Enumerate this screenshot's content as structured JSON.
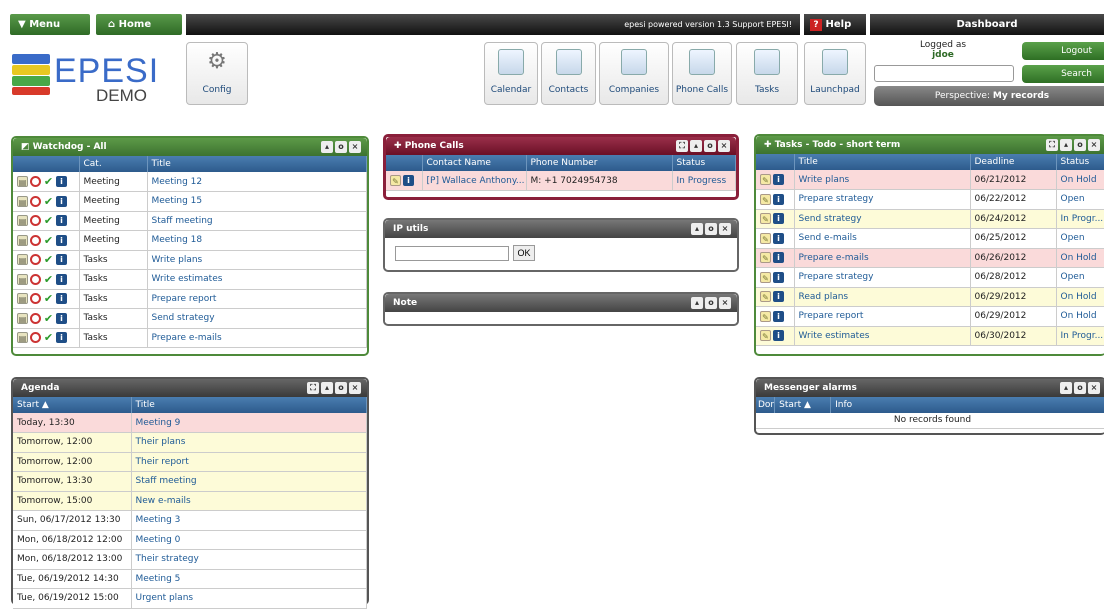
{
  "topbar": {
    "menu_label": "Menu",
    "home_label": "Home",
    "version_text": "epesi powered version 1.3  Support EPESI!",
    "help_label": "Help",
    "dashboard_label": "Dashboard",
    "logo_text": "EPESI",
    "logo_sub": "DEMO",
    "logged_as_label": "Logged as",
    "username": "jdoe",
    "logout_label": "Logout",
    "search_label": "Search",
    "search_value": "",
    "perspective_label": "Perspective:",
    "perspective_value": "My records",
    "tiles": {
      "config": "Config",
      "calendar": "Calendar",
      "contacts": "Contacts",
      "companies": "Companies",
      "phone_calls": "Phone Calls",
      "tasks": "Tasks",
      "launchpad": "Launchpad"
    }
  },
  "watchdog": {
    "title": "Watchdog - All",
    "columns": [
      "Cat.",
      "Title"
    ],
    "rows": [
      [
        "Meeting",
        "Meeting 12"
      ],
      [
        "Meeting",
        "Meeting 15"
      ],
      [
        "Meeting",
        "Staff meeting"
      ],
      [
        "Meeting",
        "Meeting 18"
      ],
      [
        "Tasks",
        "Write plans"
      ],
      [
        "Tasks",
        "Write estimates"
      ],
      [
        "Tasks",
        "Prepare report"
      ],
      [
        "Tasks",
        "Send strategy"
      ],
      [
        "Tasks",
        "Prepare e-mails"
      ]
    ]
  },
  "agenda": {
    "title": "Agenda",
    "columns": [
      "Start ▲",
      "Title"
    ],
    "rows": [
      [
        "Today, 13:30",
        "Meeting 9",
        "pink"
      ],
      [
        "Tomorrow, 12:00",
        "Their plans",
        "yel"
      ],
      [
        "Tomorrow, 12:00",
        "Their report",
        "yel"
      ],
      [
        "Tomorrow, 13:30",
        "Staff meeting",
        "yel"
      ],
      [
        "Tomorrow, 15:00",
        "New e-mails",
        "yel"
      ],
      [
        "Sun, 06/17/2012 13:30",
        "Meeting 3",
        ""
      ],
      [
        "Mon, 06/18/2012 12:00",
        "Meeting 0",
        ""
      ],
      [
        "Mon, 06/18/2012 13:00",
        "Their strategy",
        ""
      ],
      [
        "Tue, 06/19/2012 14:30",
        "Meeting 5",
        ""
      ],
      [
        "Tue, 06/19/2012 15:00",
        "Urgent plans",
        ""
      ]
    ]
  },
  "phone_calls": {
    "title": "Phone Calls",
    "columns": [
      "Contact Name",
      "Phone Number",
      "Status"
    ],
    "rows": [
      [
        "[P] Wallace Anthony...",
        "M: +1 7024954738",
        "In Progress"
      ]
    ]
  },
  "ip_utils": {
    "title": "IP utils",
    "input_value": "",
    "ok_label": "OK"
  },
  "note": {
    "title": "Note"
  },
  "tasks": {
    "title": "Tasks - Todo - short term",
    "columns": [
      "Title",
      "Deadline",
      "Status"
    ],
    "rows": [
      [
        "Write plans",
        "06/21/2012",
        "On Hold",
        "pink"
      ],
      [
        "Prepare strategy",
        "06/22/2012",
        "Open",
        ""
      ],
      [
        "Send strategy",
        "06/24/2012",
        "In Progr...",
        "yel"
      ],
      [
        "Send e-mails",
        "06/25/2012",
        "Open",
        ""
      ],
      [
        "Prepare e-mails",
        "06/26/2012",
        "On Hold",
        "pink"
      ],
      [
        "Prepare strategy",
        "06/28/2012",
        "Open",
        ""
      ],
      [
        "Read plans",
        "06/29/2012",
        "On Hold",
        "yel"
      ],
      [
        "Prepare report",
        "06/29/2012",
        "On Hold",
        ""
      ],
      [
        "Write estimates",
        "06/30/2012",
        "In Progr...",
        "yel"
      ]
    ]
  },
  "messenger": {
    "title": "Messenger alarms",
    "columns": [
      "Dor",
      "Start ▲",
      "Info"
    ],
    "empty_text": "No records found"
  },
  "colors": {
    "green_border": "#4e8a3a",
    "red_border": "#8a1f3a",
    "grey_header": "#555555",
    "header_blue": "#2d5b8c"
  }
}
